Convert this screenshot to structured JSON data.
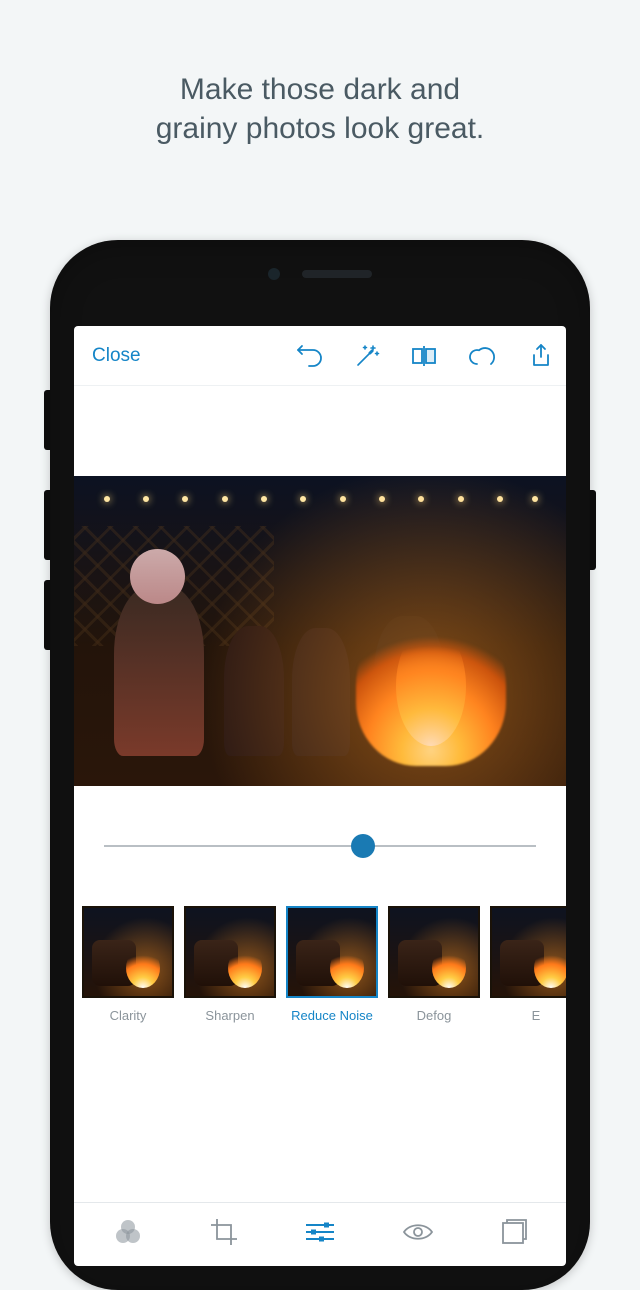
{
  "promo": {
    "line1": "Make those dark and",
    "line2": "grainy photos look great."
  },
  "topbar": {
    "close_label": "Close"
  },
  "slider": {
    "value_percent": 60
  },
  "filters": {
    "items": [
      {
        "label": "Clarity",
        "selected": false
      },
      {
        "label": "Sharpen",
        "selected": false
      },
      {
        "label": "Reduce Noise",
        "selected": true
      },
      {
        "label": "Defog",
        "selected": false
      },
      {
        "label": "E",
        "selected": false
      }
    ]
  },
  "bottom_nav": {
    "active_index": 2
  },
  "colors": {
    "accent": "#1585c7"
  }
}
